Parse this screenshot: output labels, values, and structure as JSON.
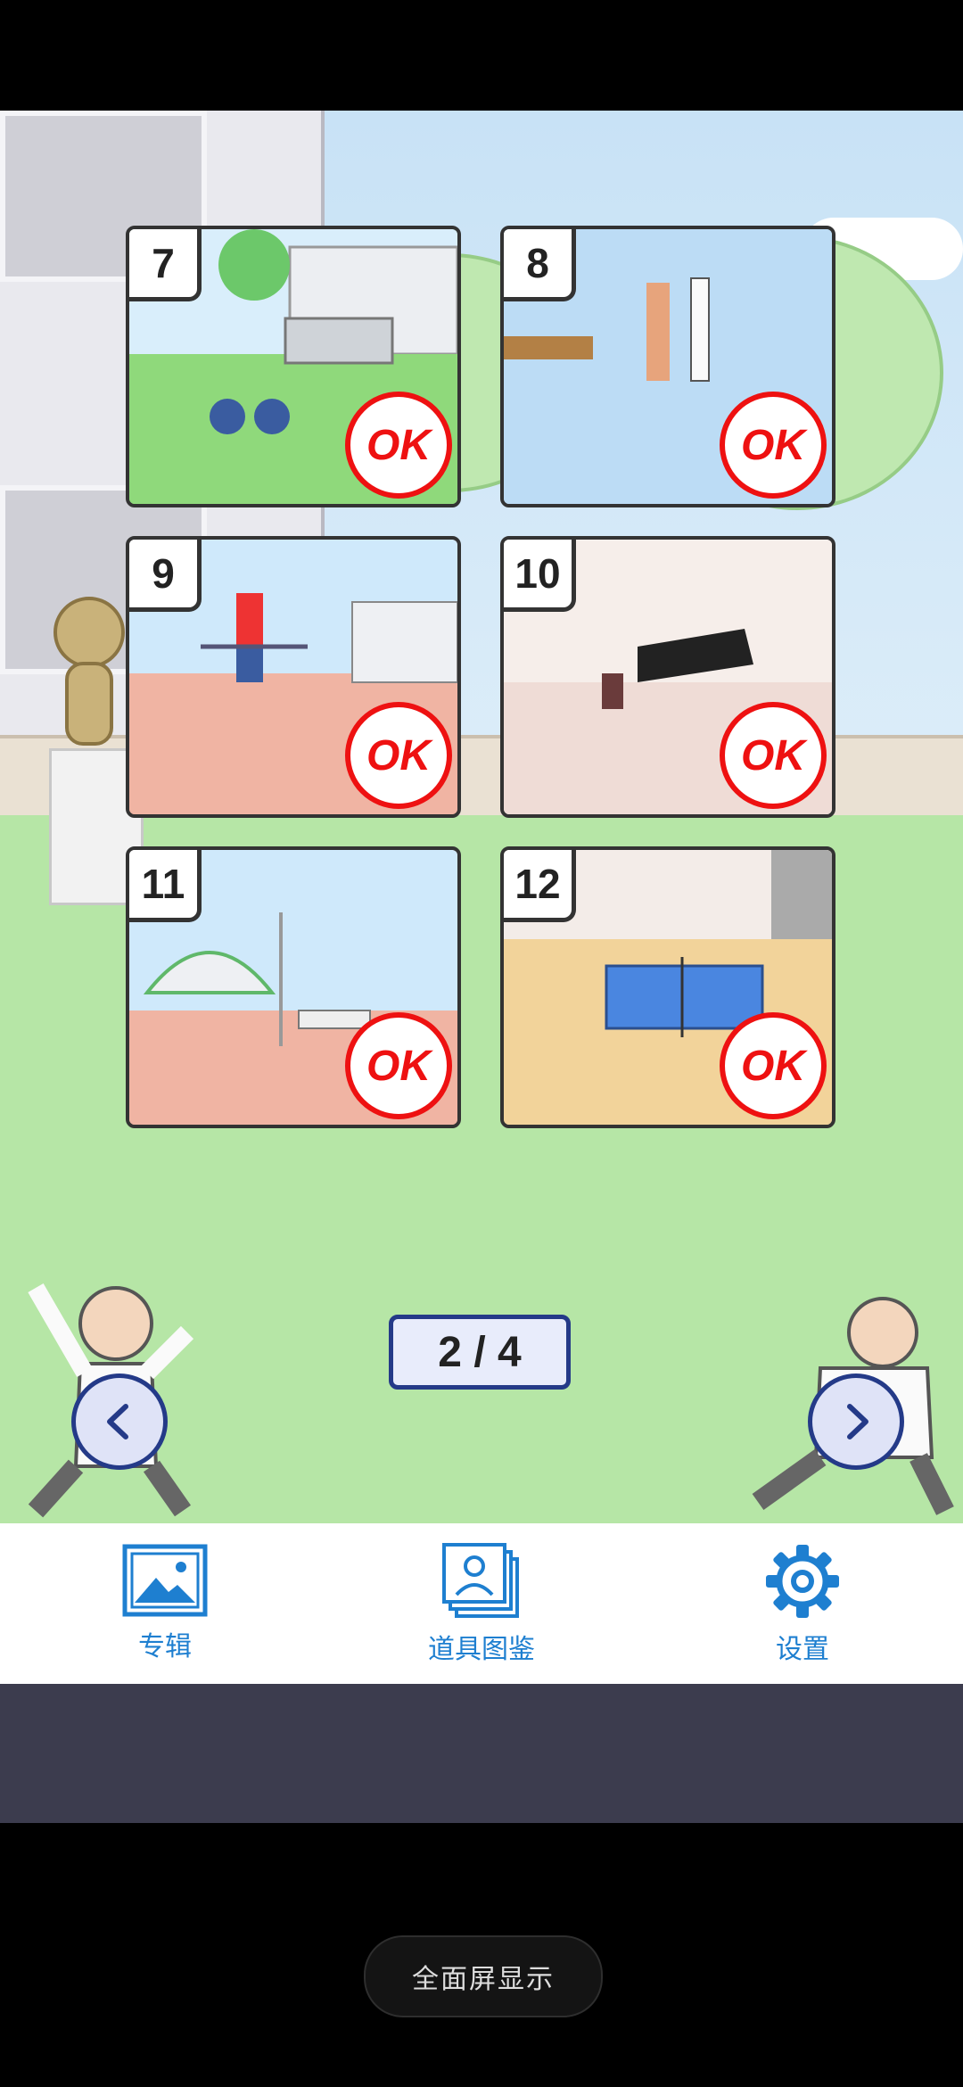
{
  "levels": [
    {
      "number": "7",
      "status": "OK"
    },
    {
      "number": "8",
      "status": "OK"
    },
    {
      "number": "9",
      "status": "OK"
    },
    {
      "number": "10",
      "status": "OK"
    },
    {
      "number": "11",
      "status": "OK"
    },
    {
      "number": "12",
      "status": "OK"
    }
  ],
  "pager": {
    "text": "2 / 4",
    "current": 2,
    "total": 4
  },
  "tabs": [
    {
      "label": "专辑",
      "icon": "picture-icon"
    },
    {
      "label": "道具图鉴",
      "icon": "gallery-stack-icon"
    },
    {
      "label": "设置",
      "icon": "gear-icon"
    }
  ],
  "fullscreen": {
    "label": "全面屏显示"
  },
  "colors": {
    "accent": "#1e7fd0",
    "ok_red": "#e11111",
    "pager_border": "#243a88"
  }
}
